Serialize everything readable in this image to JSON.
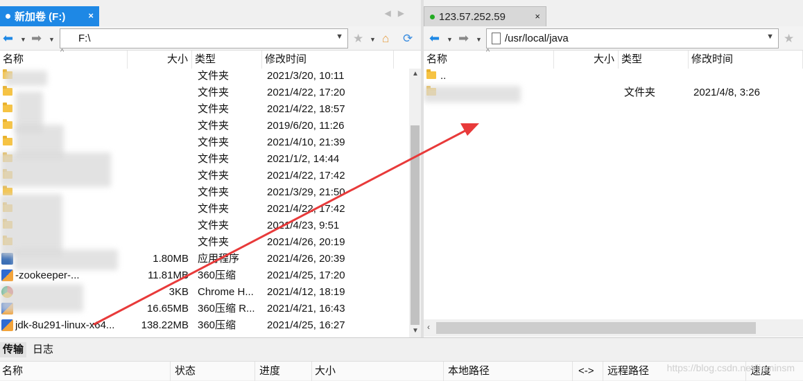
{
  "left_pane": {
    "tab_title": "新加卷 (F:)",
    "tab_close": "×",
    "address": "F:\\",
    "columns": [
      "名称",
      "大小",
      "类型",
      "修改时间"
    ],
    "rows": [
      {
        "name": "",
        "size": "",
        "type": "文件夹",
        "modified": "2021/3/20, 10:11",
        "icon": "folder-icon"
      },
      {
        "name": "",
        "size": "",
        "type": "文件夹",
        "modified": "2021/4/22, 17:20",
        "icon": "folder-icon"
      },
      {
        "name": "",
        "size": "",
        "type": "文件夹",
        "modified": "2021/4/22, 18:57",
        "icon": "folder-icon"
      },
      {
        "name": "",
        "size": "",
        "type": "文件夹",
        "modified": "2019/6/20, 11:26",
        "icon": "folder-icon"
      },
      {
        "name": "",
        "size": "",
        "type": "文件夹",
        "modified": "2021/4/10, 21:39",
        "icon": "folder-icon"
      },
      {
        "name": "",
        "size": "",
        "type": "文件夹",
        "modified": "2021/1/2, 14:44",
        "icon": "folder-icon"
      },
      {
        "name": "",
        "size": "",
        "type": "文件夹",
        "modified": "2021/4/22, 17:42",
        "icon": "folder-icon"
      },
      {
        "name": "",
        "size": "",
        "type": "文件夹",
        "modified": "2021/3/29, 21:50",
        "icon": "folder-icon"
      },
      {
        "name": "",
        "size": "",
        "type": "文件夹",
        "modified": "2021/4/22, 17:42",
        "icon": "folder-icon"
      },
      {
        "name": "",
        "size": "",
        "type": "文件夹",
        "modified": "2021/4/23, 9:51",
        "icon": "folder-icon"
      },
      {
        "name": "",
        "size": "",
        "type": "文件夹",
        "modified": "2021/4/26, 20:19",
        "icon": "folder-icon"
      },
      {
        "name": "",
        "size": "1.80MB",
        "type": "应用程序",
        "modified": "2021/4/26, 20:39",
        "icon": "app-icon"
      },
      {
        "name": "-zookeeper-...",
        "size": "11.81MB",
        "type": "360压缩",
        "modified": "2021/4/25, 17:20",
        "icon": "archive-icon"
      },
      {
        "name": "",
        "size": "3KB",
        "type": "Chrome H...",
        "modified": "2021/4/12, 18:19",
        "icon": "chrome-icon"
      },
      {
        "name": "",
        "size": "16.65MB",
        "type": "360压缩 R...",
        "modified": "2021/4/21, 16:43",
        "icon": "archive-icon"
      },
      {
        "name": "jdk-8u291-linux-x64...",
        "size": "138.22MB",
        "type": "360压缩",
        "modified": "2021/4/25, 16:27",
        "icon": "archive-icon"
      }
    ]
  },
  "right_pane": {
    "tab_title": "123.57.252.59",
    "tab_close": "×",
    "address": "/usr/local/java",
    "columns": [
      "名称",
      "大小",
      "类型",
      "修改时间"
    ],
    "rows": [
      {
        "name": "..",
        "size": "",
        "type": "",
        "modified": "",
        "icon": "folder-icon"
      },
      {
        "name": "",
        "size": "",
        "type": "文件夹",
        "modified": "2021/4/8, 3:26",
        "icon": "folder-icon"
      }
    ]
  },
  "bottom": {
    "tabs": [
      "传输",
      "日志"
    ],
    "columns": [
      "名称",
      "状态",
      "进度",
      "大小",
      "本地路径",
      "<->",
      "远程路径",
      "速度"
    ],
    "watermark": "https://blog.csdn.net/jiaminsm"
  },
  "colors": {
    "accent": "#1e88e5",
    "connected": "#22aa22",
    "arrow": "#e83a3a"
  }
}
